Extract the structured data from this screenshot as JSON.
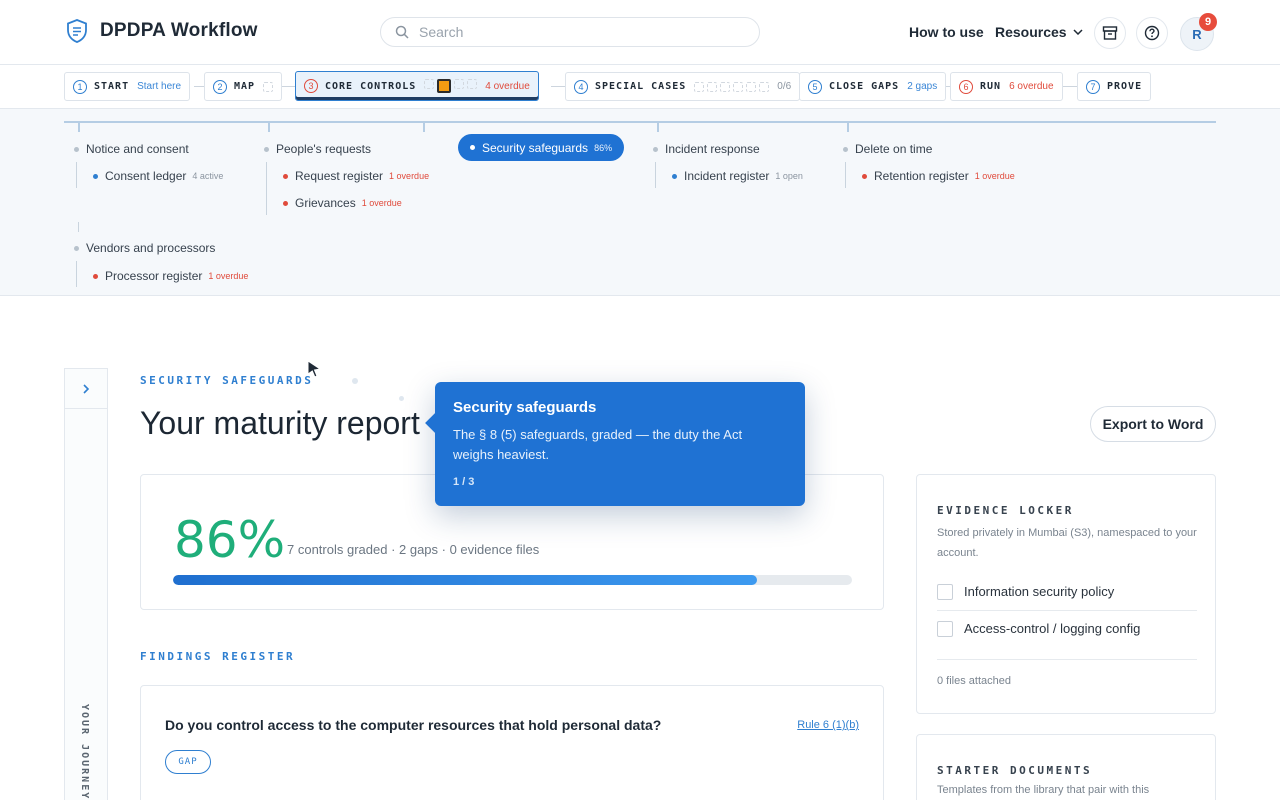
{
  "header": {
    "brand": "DPDPA Workflow",
    "search_placeholder": "Search",
    "how_to_use": "How to use",
    "resources": "Resources",
    "avatar_initial": "R",
    "notification_count": "9",
    "icons": [
      "shield-logo-icon",
      "search-icon",
      "chevron-down-icon",
      "archive-icon",
      "help-icon"
    ]
  },
  "steps": [
    {
      "num": "1",
      "label": "START",
      "sub": "Start here",
      "tone": "blue"
    },
    {
      "num": "2",
      "label": "MAP",
      "sub": "",
      "tone": "blue"
    },
    {
      "num": "3",
      "label": "CORE CONTROLS",
      "sub": "4 overdue",
      "tone": "red",
      "active": true
    },
    {
      "num": "4",
      "label": "SPECIAL CASES",
      "sub": "0/6",
      "tone": "grey"
    },
    {
      "num": "5",
      "label": "CLOSE GAPS",
      "sub": "2 gaps",
      "tone": "blue"
    },
    {
      "num": "6",
      "label": "RUN",
      "sub": "6 overdue",
      "tone": "red"
    },
    {
      "num": "7",
      "label": "PROVE",
      "sub": "",
      "tone": "blue"
    }
  ],
  "subnav": {
    "categories": {
      "notice": "Notice and consent",
      "requests": "People's requests",
      "security": "Security safeguards",
      "incident": "Incident response",
      "delete": "Delete on time",
      "vendors": "Vendors and processors"
    },
    "security_pct": "86%",
    "items": {
      "consent_ledger": {
        "label": "Consent ledger",
        "meta": "4 active"
      },
      "request_register": {
        "label": "Request register",
        "meta": "1 overdue"
      },
      "grievances": {
        "label": "Grievances",
        "meta": "1 overdue"
      },
      "incident_register": {
        "label": "Incident register",
        "meta": "1 open"
      },
      "retention_register": {
        "label": "Retention register",
        "meta": "1 overdue"
      },
      "processor_register": {
        "label": "Processor register",
        "meta": "1 overdue"
      }
    }
  },
  "rail": {
    "label": "YOUR JOURNEY"
  },
  "main": {
    "eyebrow": "SECURITY SAFEGUARDS",
    "title": "Your maturity report",
    "export_label": "Export to Word",
    "score": {
      "pct": "86%",
      "value": 0.86,
      "meta": "7 controls graded · 2 gaps · 0 evidence files",
      "progress_fraction": 0.86
    },
    "findings_label": "FINDINGS REGISTER",
    "finding": {
      "question": "Do you control access to the computer resources that hold personal data?",
      "rule": "Rule 6 (1)(b)",
      "status": "GAP"
    }
  },
  "evidence_locker": {
    "title": "EVIDENCE LOCKER",
    "desc": "Stored privately in Mumbai (S3), namespaced to your account.",
    "items": [
      "Information security policy",
      "Access-control / logging config"
    ],
    "footer": "0 files attached"
  },
  "starter_documents": {
    "title": "STARTER DOCUMENTS",
    "desc": "Templates from the library that pair with this"
  },
  "tooltip": {
    "title": "Security safeguards",
    "body": "The § 8 (5) safeguards, graded — the duty the Act weighs heaviest.",
    "step": "1 / 3"
  },
  "colors": {
    "accent": "#1f72d3",
    "success": "#1fae7a",
    "danger": "#e04b3c",
    "highlight": "#f39c12"
  }
}
